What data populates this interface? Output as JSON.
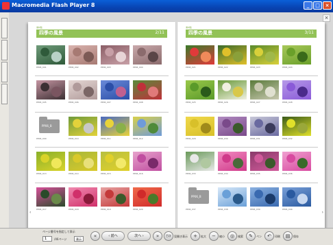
{
  "window": {
    "title": "Macromedia Flash Player 8",
    "minimize": "_",
    "maximize": "□",
    "close": "×"
  },
  "sidebar": {
    "tabs": [
      "",
      "",
      "",
      "",
      "",
      ""
    ]
  },
  "book": {
    "close_mark": "×",
    "nav_prev": "‹",
    "nav_next": "›",
    "left_page": {
      "header_small": "素材集",
      "title": "四季の風景",
      "page_no": "2/11",
      "rows": [
        {
          "items": [
            {
              "caption": "PP06_001",
              "palette": [
                "#2f5a3a",
                "#6f9b7a",
                "#b9d2c7"
              ]
            },
            {
              "caption": "PP06_002",
              "palette": [
                "#a77a73",
                "#d9b3ae",
                "#7c5a55"
              ]
            },
            {
              "caption": "PP06_003",
              "palette": [
                "#c79fa6",
                "#8b5e66",
                "#e8d4d6"
              ]
            },
            {
              "caption": "PP06_004",
              "palette": [
                "#8b6b6d",
                "#c9a9ab",
                "#5a4547"
              ]
            }
          ]
        },
        {
          "items": [
            {
              "caption": "PP06_005",
              "palette": [
                "#3c2f33",
                "#c595a2",
                "#7a5560"
              ]
            },
            {
              "caption": "PP06_006",
              "palette": [
                "#b09a9a",
                "#e5d7d4",
                "#7b6666"
              ]
            },
            {
              "caption": "PP06_007",
              "palette": [
                "#2b4ea7",
                "#6a8ad9",
                "#c06090"
              ]
            },
            {
              "caption": "PP06_008",
              "palette": [
                "#c0303a",
                "#5a8a3a",
                "#e07a7a"
              ]
            }
          ]
        },
        {
          "items": [
            {
              "caption": "PP06_009",
              "folder": true,
              "label": "PP06_B"
            },
            {
              "caption": "PP06_010",
              "palette": [
                "#e3d23a",
                "#6f9a3a",
                "#c8c8c8"
              ]
            },
            {
              "caption": "PP06_011",
              "palette": [
                "#e8d33a",
                "#4a6ac0",
                "#8ab04a"
              ]
            },
            {
              "caption": "PP06_012",
              "palette": [
                "#6f9bd9",
                "#d8d04a",
                "#4f8a3a"
              ]
            }
          ]
        },
        {
          "items": [
            {
              "caption": "PP06_013",
              "palette": [
                "#d9d32a",
                "#8ab02a",
                "#f0e85a"
              ]
            },
            {
              "caption": "PP06_014",
              "palette": [
                "#d9c92a",
                "#a7b83a",
                "#e8e07a"
              ]
            },
            {
              "caption": "PP06_015",
              "palette": [
                "#e0d02a",
                "#b8c040",
                "#f3ea6a"
              ]
            },
            {
              "caption": "PP06_016",
              "palette": [
                "#c04ea0",
                "#e7a2cc",
                "#7a2a6a"
              ]
            }
          ]
        },
        {
          "items": [
            {
              "caption": "PP06_017",
              "palette": [
                "#2a4a2a",
                "#d7509a",
                "#6a8a4a"
              ]
            },
            {
              "caption": "PP06_018",
              "palette": [
                "#d0306a",
                "#f08ab0",
                "#8a1a3a"
              ]
            },
            {
              "caption": "PP06_019",
              "palette": [
                "#c43a3a",
                "#e7a2a2",
                "#3a5a2a"
              ]
            },
            {
              "caption": "PP06_020",
              "palette": [
                "#d02a2a",
                "#f06a4a",
                "#4a7a2a"
              ]
            }
          ]
        }
      ]
    },
    "right_page": {
      "header_small": "素材集",
      "title": "四季の風景",
      "page_no": "3/11",
      "rows": [
        {
          "items": [
            {
              "caption": "PP06_021",
              "palette": [
                "#e03a3a",
                "#3a7a2a",
                "#f08a5a"
              ]
            },
            {
              "caption": "PP06_022",
              "palette": [
                "#e0c02a",
                "#3a6a2a",
                "#8aa03a"
              ]
            },
            {
              "caption": "PP06_023",
              "palette": [
                "#d8d03a",
                "#5a8a2a",
                "#a0b84a"
              ]
            },
            {
              "caption": "PP06_024",
              "palette": [
                "#6aa02a",
                "#a8c85a",
                "#3a6a1a"
              ]
            }
          ]
        },
        {
          "items": [
            {
              "caption": "PP06_025",
              "palette": [
                "#5a9a2a",
                "#9ac84a",
                "#2a5a1a"
              ]
            },
            {
              "caption": "PP06_026",
              "palette": [
                "#f0f0e0",
                "#6a9a3a",
                "#d8c84a"
              ]
            },
            {
              "caption": "PP06_027",
              "palette": [
                "#c8c8b0",
                "#5a7a3a",
                "#e0e0d0"
              ]
            },
            {
              "caption": "PP06_028",
              "palette": [
                "#8a5ad8",
                "#b69ae8",
                "#4a2a8a"
              ]
            }
          ]
        },
        {
          "items": [
            {
              "caption": "PP06_029",
              "palette": [
                "#d8c02a",
                "#f0d84a",
                "#a08a1a"
              ]
            },
            {
              "caption": "PP06_030",
              "palette": [
                "#7a4a8a",
                "#b08ac0",
                "#3a5a2a"
              ]
            },
            {
              "caption": "PP06_031",
              "palette": [
                "#6a6aa0",
                "#c8c8d8",
                "#3a3a5a"
              ]
            },
            {
              "caption": "PP06_032",
              "palette": [
                "#e0e02a",
                "#3a5a1a",
                "#9aa83a"
              ]
            }
          ]
        },
        {
          "items": [
            {
              "caption": "PP06_033",
              "palette": [
                "#e8e8e8",
                "#6a9a5a",
                "#b0c8a0"
              ]
            },
            {
              "caption": "PP06_034",
              "palette": [
                "#d03a8a",
                "#f08ac0",
                "#4a6a3a"
              ]
            },
            {
              "caption": "PP06_035",
              "palette": [
                "#d05a9a",
                "#8a3a6a",
                "#3a5a2a"
              ]
            },
            {
              "caption": "PP06_036",
              "palette": [
                "#d84aa0",
                "#f0a0d0",
                "#3a6a2a"
              ]
            }
          ]
        },
        {
          "items": [
            {
              "caption": "PP06_037",
              "folder": true,
              "label": "PP06_B"
            },
            {
              "caption": "PP06_038",
              "palette": [
                "#6aa0d8",
                "#d8e8f8",
                "#2a5a8a"
              ]
            },
            {
              "caption": "PP06_039",
              "palette": [
                "#3a6ab0",
                "#8ab0e0",
                "#1a3a6a"
              ]
            },
            {
              "caption": "PP06_040",
              "palette": [
                "#2a5aa0",
                "#7aa0d8",
                "#c8d8f0"
              ]
            }
          ]
        }
      ]
    }
  },
  "toolbar": {
    "checkbox_label": "ページ番号を指定して表示",
    "page_input": "1",
    "page_total": "/46ページ",
    "go_button": "表示",
    "first_button": "«",
    "prev_button": "‹ 前へ",
    "next_button": "次へ ›",
    "last_button": "»",
    "thumbnail_button": "目次",
    "thumbnail_text": "見開き表示",
    "zoom_in_icon": "+",
    "zoom_in_text": "拡大",
    "zoom_out_icon": "−",
    "zoom_out_text": "縮小",
    "search_icon": "◎",
    "search_text": "検索",
    "pen_icon": "✎",
    "pen_text": "ペン",
    "undo_icon": "↶",
    "undo_text": "印刷",
    "print_icon": "▤",
    "print_text": "保存"
  }
}
